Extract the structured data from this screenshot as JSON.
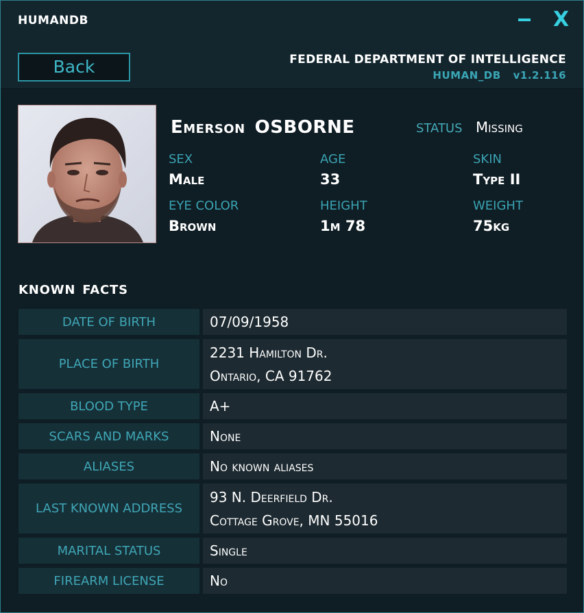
{
  "window": {
    "title": "HUMANDB",
    "minimize_label": "-",
    "close_label": "X"
  },
  "header": {
    "back_label": "Back",
    "agency": "FEDERAL DEPARTMENT OF INTELLIGENCE",
    "db_name": "HUMAN_DB",
    "version": "v1.2.116"
  },
  "profile": {
    "first_name": "Emerson",
    "last_name": "OSBORNE",
    "status_label": "STATUS",
    "status_value": "Missing",
    "attributes": [
      {
        "label": "SEX",
        "value": "Male"
      },
      {
        "label": "AGE",
        "value": "33"
      },
      {
        "label": "SKIN",
        "value": "Type II"
      },
      {
        "label": "EYE COLOR",
        "value": "Brown"
      },
      {
        "label": "HEIGHT",
        "value": "1m 78"
      },
      {
        "label": "WEIGHT",
        "value": "75kg"
      }
    ]
  },
  "known_facts": {
    "title_1": "KNOWN",
    "title_2": "FACTS",
    "rows": [
      {
        "label": "DATE OF BIRTH",
        "lines": [
          "07/09/1958"
        ]
      },
      {
        "label": "PLACE OF BIRTH",
        "lines": [
          "2231 Hamilton Dr.",
          "Ontario, CA 91762"
        ]
      },
      {
        "label": "BLOOD TYPE",
        "lines": [
          "A+"
        ]
      },
      {
        "label": "SCARS AND MARKS",
        "lines": [
          "None"
        ]
      },
      {
        "label": "ALIASES",
        "lines": [
          "No known aliases"
        ]
      },
      {
        "label": "LAST KNOWN ADDRESS",
        "lines": [
          "93 N. Deerfield Dr.",
          "Cottage Grove, MN 55016"
        ]
      },
      {
        "label": "MARITAL STATUS",
        "lines": [
          "Single"
        ]
      },
      {
        "label": "FIREARM LICENSE",
        "lines": [
          "No"
        ]
      }
    ]
  },
  "colors": {
    "accent": "#37d0e0",
    "label": "#3fa7b6",
    "background": "#0f1d24"
  }
}
